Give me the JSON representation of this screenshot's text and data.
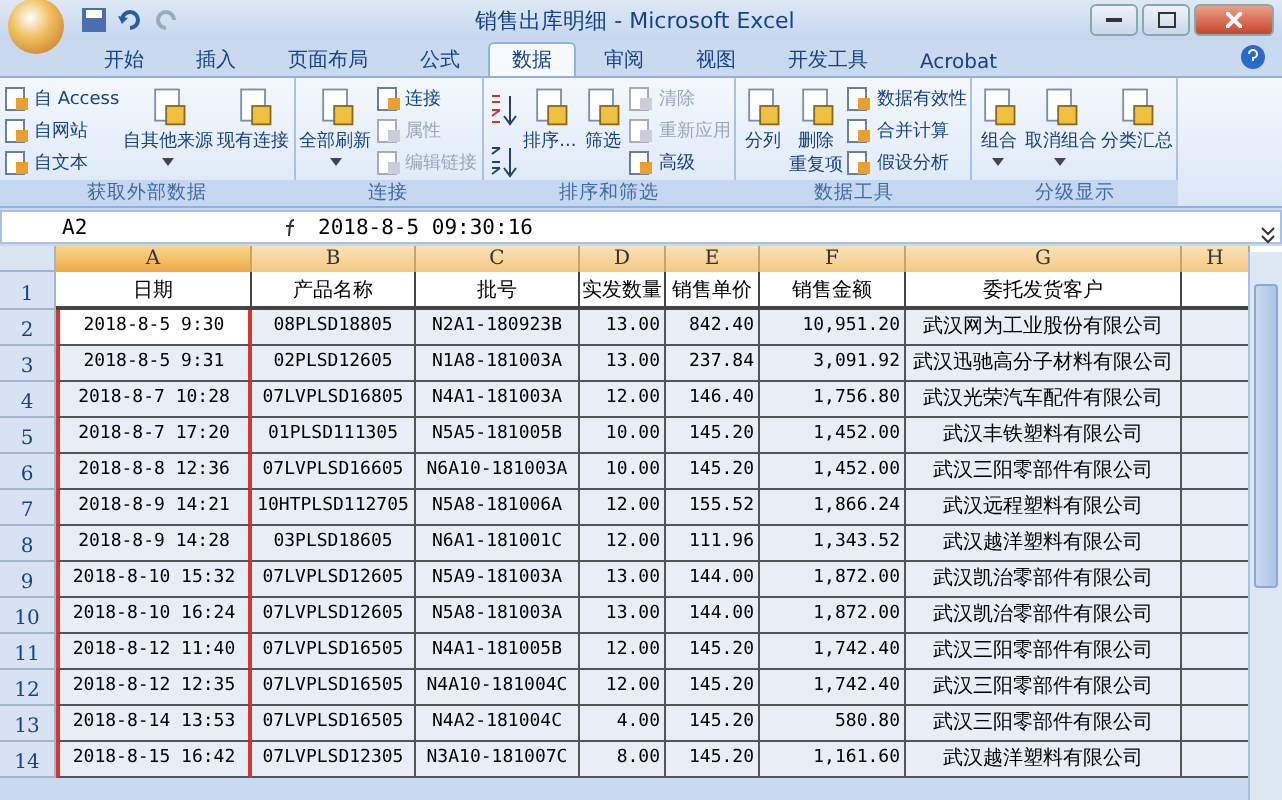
{
  "window": {
    "title": "销售出库明细 - Microsoft Excel"
  },
  "tabs": [
    {
      "label": "开始",
      "selected": false
    },
    {
      "label": "插入",
      "selected": false
    },
    {
      "label": "页面布局",
      "selected": false
    },
    {
      "label": "公式",
      "selected": false
    },
    {
      "label": "数据",
      "selected": true
    },
    {
      "label": "审阅",
      "selected": false
    },
    {
      "label": "视图",
      "selected": false
    },
    {
      "label": "开发工具",
      "selected": false
    },
    {
      "label": "Acrobat",
      "selected": false
    }
  ],
  "ribbon_groups": [
    {
      "label": "获取外部数据",
      "columns": [
        {
          "kind": "stack",
          "items": [
            {
              "label": "自 Access",
              "disabled": false
            },
            {
              "label": "自网站",
              "disabled": false
            },
            {
              "label": "自文本",
              "disabled": false
            }
          ]
        },
        {
          "kind": "large",
          "label": "自其他来源",
          "dropdown": true
        },
        {
          "kind": "large",
          "label": "现有连接",
          "dropdown": false
        }
      ]
    },
    {
      "label": "连接",
      "columns": [
        {
          "kind": "large",
          "label": "全部刷新",
          "dropdown": true
        },
        {
          "kind": "stack",
          "items": [
            {
              "label": "连接",
              "disabled": false
            },
            {
              "label": "属性",
              "disabled": true
            },
            {
              "label": "编辑链接",
              "disabled": true
            }
          ]
        }
      ]
    },
    {
      "label": "排序和筛选",
      "columns": [
        {
          "kind": "sort"
        },
        {
          "kind": "large",
          "label": "排序...",
          "dropdown": false
        },
        {
          "kind": "large",
          "label": "筛选",
          "dropdown": false
        },
        {
          "kind": "stack",
          "items": [
            {
              "label": "清除",
              "disabled": true
            },
            {
              "label": "重新应用",
              "disabled": true
            },
            {
              "label": "高级",
              "disabled": false
            }
          ]
        }
      ]
    },
    {
      "label": "数据工具",
      "columns": [
        {
          "kind": "large",
          "label": "分列",
          "dropdown": false
        },
        {
          "kind": "large",
          "label": "删除",
          "label_2": "重复项",
          "dropdown": false
        },
        {
          "kind": "stack",
          "items": [
            {
              "label": "数据有效性",
              "disabled": false
            },
            {
              "label": "合并计算",
              "disabled": false
            },
            {
              "label": "假设分析",
              "disabled": false
            }
          ]
        }
      ]
    },
    {
      "label": "分级显示",
      "columns": [
        {
          "kind": "large",
          "label": "组合",
          "dropdown": true
        },
        {
          "kind": "large",
          "label": "取消组合",
          "dropdown": true
        },
        {
          "kind": "large",
          "label": "分类汇总",
          "dropdown": false
        }
      ]
    }
  ],
  "formula_bar": {
    "name_box": "A2",
    "value": "2018-8-5  09:30:16"
  },
  "columns": [
    {
      "letter": "A",
      "selected": true,
      "outlined": true
    },
    {
      "letter": "B",
      "selected": false,
      "outlined": false
    },
    {
      "letter": "C",
      "selected": false,
      "outlined": false
    },
    {
      "letter": "D",
      "selected": false,
      "outlined": false
    },
    {
      "letter": "E",
      "selected": false,
      "outlined": false
    },
    {
      "letter": "F",
      "selected": false,
      "outlined": false
    },
    {
      "letter": "G",
      "selected": false,
      "outlined": false
    },
    {
      "letter": "H",
      "selected": false,
      "outlined": false
    }
  ],
  "header_row": {
    "number": "1",
    "cells": [
      "日期",
      "产品名称",
      "批号",
      "实发数量",
      "销售单价",
      "销售金额",
      "委托发货客户"
    ]
  },
  "rows": [
    {
      "number": "2",
      "cells": [
        "2018-8-5 9:30",
        "08PLSD18805",
        "N2A1-180923B",
        "13.00",
        "842.40",
        "10,951.20",
        "武汉网为工业股份有限公司"
      ]
    },
    {
      "number": "3",
      "cells": [
        "2018-8-5 9:31",
        "02PLSD12605",
        "N1A8-181003A",
        "13.00",
        "237.84",
        "3,091.92",
        "武汉迅驰高分子材料有限公司"
      ]
    },
    {
      "number": "4",
      "cells": [
        "2018-8-7 10:28",
        "07LVPLSD16805",
        "N4A1-181003A",
        "12.00",
        "146.40",
        "1,756.80",
        "武汉光荣汽车配件有限公司"
      ]
    },
    {
      "number": "5",
      "cells": [
        "2018-8-7 17:20",
        "01PLSD111305",
        "N5A5-181005B",
        "10.00",
        "145.20",
        "1,452.00",
        "武汉丰铁塑料有限公司"
      ]
    },
    {
      "number": "6",
      "cells": [
        "2018-8-8 12:36",
        "07LVPLSD16605",
        "N6A10-181003A",
        "10.00",
        "145.20",
        "1,452.00",
        "武汉三阳零部件有限公司"
      ]
    },
    {
      "number": "7",
      "cells": [
        "2018-8-9 14:21",
        "10HTPLSD112705",
        "N5A8-181006A",
        "12.00",
        "155.52",
        "1,866.24",
        "武汉远程塑料有限公司"
      ]
    },
    {
      "number": "8",
      "cells": [
        "2018-8-9 14:28",
        "03PLSD18605",
        "N6A1-181001C",
        "12.00",
        "111.96",
        "1,343.52",
        "武汉越洋塑料有限公司"
      ]
    },
    {
      "number": "9",
      "cells": [
        "2018-8-10 15:32",
        "07LVPLSD12605",
        "N5A9-181003A",
        "13.00",
        "144.00",
        "1,872.00",
        "武汉凯治零部件有限公司"
      ]
    },
    {
      "number": "10",
      "cells": [
        "2018-8-10 16:24",
        "07LVPLSD12605",
        "N5A8-181003A",
        "13.00",
        "144.00",
        "1,872.00",
        "武汉凯治零部件有限公司"
      ]
    },
    {
      "number": "11",
      "cells": [
        "2018-8-12 11:40",
        "07LVPLSD16505",
        "N4A1-181005B",
        "12.00",
        "145.20",
        "1,742.40",
        "武汉三阳零部件有限公司"
      ]
    },
    {
      "number": "12",
      "cells": [
        "2018-8-12 12:35",
        "07LVPLSD16505",
        "N4A10-181004C",
        "12.00",
        "145.20",
        "1,742.40",
        "武汉三阳零部件有限公司"
      ]
    },
    {
      "number": "13",
      "cells": [
        "2018-8-14 13:53",
        "07LVPLSD16505",
        "N4A2-181004C",
        "4.00",
        "145.20",
        "580.80",
        "武汉三阳零部件有限公司"
      ]
    },
    {
      "number": "14",
      "cells": [
        "2018-8-15 16:42",
        "07LVPLSD12305",
        "N3A10-181007C",
        "8.00",
        "145.20",
        "1,161.60",
        "武汉越洋塑料有限公司"
      ]
    }
  ]
}
